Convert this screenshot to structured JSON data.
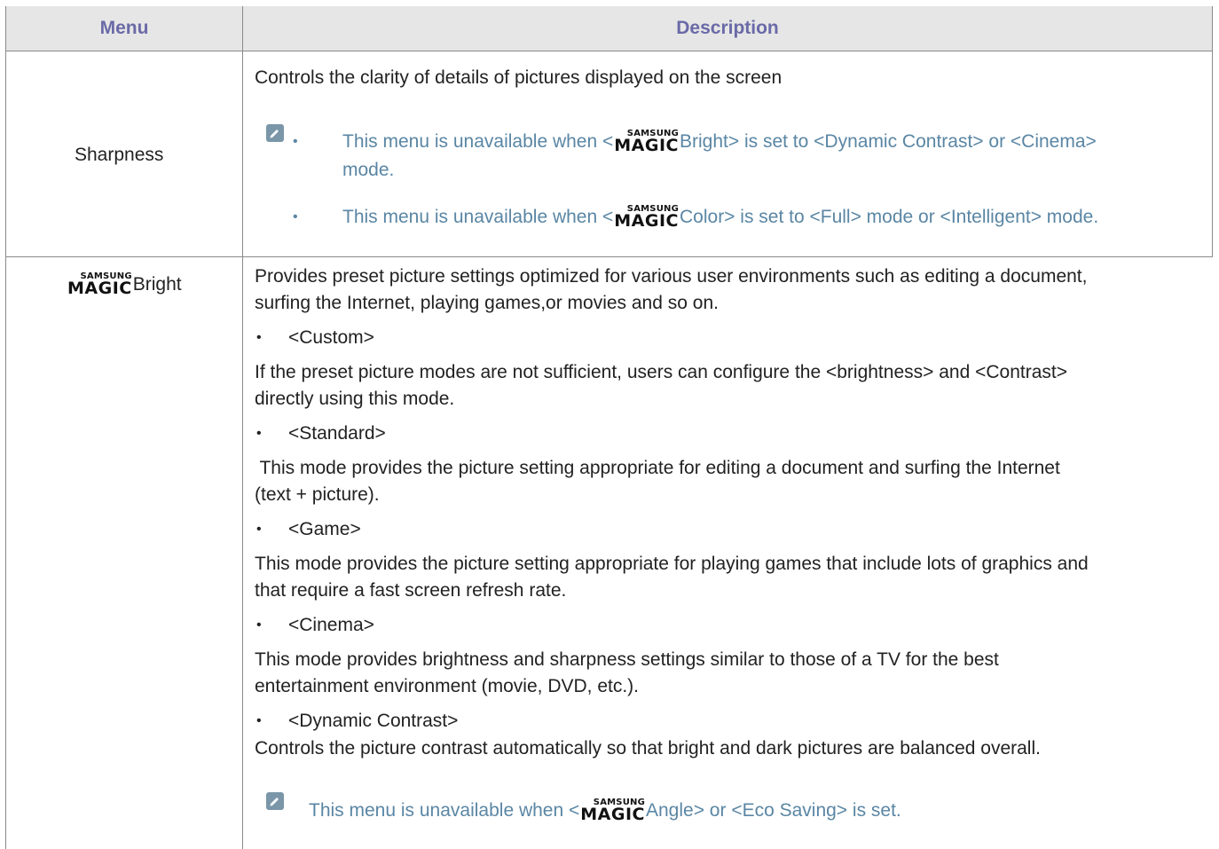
{
  "table": {
    "header": {
      "menu": "Menu",
      "description": "Description"
    },
    "rows": [
      {
        "menu_label": "Sharpness",
        "intro": "Controls the clarity of details of pictures displayed on the screen",
        "notes": [
          {
            "pre": "This menu is unavailable when <",
            "brand_small": "SAMSUNG",
            "brand_big": "MAGIC",
            "post": "Bright> is set to <Dynamic Contrast> or <Cinema>",
            "line2": "mode."
          },
          {
            "pre": "This menu is unavailable when <",
            "brand_small": "SAMSUNG",
            "brand_big": "MAGIC",
            "post": "Color> is set to <Full> mode or <Intelligent> mode."
          }
        ]
      },
      {
        "menu_brand_small": "SAMSUNG",
        "menu_brand_big": "MAGIC",
        "menu_label": "Bright",
        "intro_lines": [
          "Provides preset picture settings optimized for various user environments such as editing a document,",
          "surfing the Internet, playing games,or movies and so on."
        ],
        "modes": [
          {
            "name": "<Custom>",
            "desc": [
              "If the preset picture modes are not sufficient, users can configure the <brightness> and <Contrast>",
              "directly using this mode."
            ]
          },
          {
            "name": "<Standard>",
            "desc": [
              " This mode provides the picture setting appropriate for editing a document and surfing the Internet",
              "(text + picture)."
            ]
          },
          {
            "name": "<Game>",
            "desc": [
              "This mode provides the picture setting appropriate for playing games that include lots of graphics and",
              "that require a fast screen refresh rate."
            ]
          },
          {
            "name": "<Cinema>",
            "desc": [
              "This mode provides brightness and sharpness settings similar to those of a TV for the best",
              "entertainment environment (movie, DVD, etc.)."
            ]
          },
          {
            "name": "<Dynamic Contrast>",
            "desc": [
              "Controls the picture contrast automatically so that bright and dark pictures are balanced overall."
            ]
          }
        ],
        "note": {
          "pre": "This menu is unavailable when <",
          "brand_small": "SAMSUNG",
          "brand_big": "MAGIC",
          "post": "Angle> or <Eco Saving> is set."
        }
      }
    ],
    "bullet_char": "•",
    "colors": {
      "header_bg": "#e6e6e6",
      "header_text": "#6a6aa8",
      "note_text": "#5a86a4",
      "border": "#8a8a8a"
    },
    "icons": {
      "note": "note-pencil-icon"
    }
  }
}
